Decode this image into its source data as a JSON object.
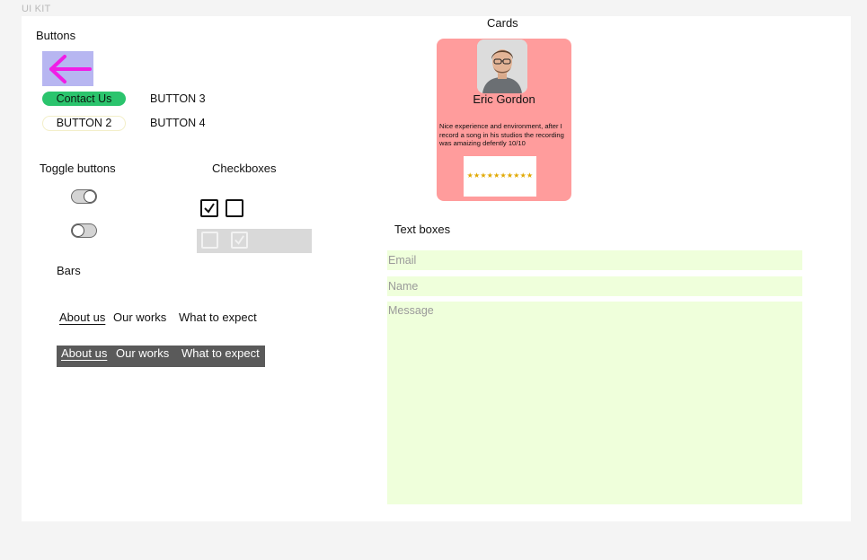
{
  "page_label": "UI KIT",
  "sections": {
    "buttons": "Buttons",
    "toggles": "Toggle buttons",
    "checkboxes": "Checkboxes",
    "bars": "Bars",
    "cards": "Cards",
    "text_boxes": "Text boxes"
  },
  "buttons": {
    "back_icon": "arrow-left-icon",
    "contact_label": "Contact Us",
    "button2_label": "BUTTON 2",
    "button3_label": "BUTTON 3",
    "button4_label": "BUTTON 4"
  },
  "toggles": [
    {
      "state": "on"
    },
    {
      "state": "off"
    }
  ],
  "checkboxes": {
    "enabled": [
      {
        "checked": true
      },
      {
        "checked": false
      }
    ],
    "disabled": [
      {
        "checked": false
      },
      {
        "checked": true
      }
    ]
  },
  "bars": {
    "light": [
      "About us",
      "Our works",
      "What to expect"
    ],
    "dark": [
      "About us",
      "Our works",
      "What to expect"
    ]
  },
  "card": {
    "name": "Eric Gordon",
    "review": "Nice experience and environment, after I record a song in his studios the recording was amaizing defently 10/10",
    "rating": "★★★★★★★★★★"
  },
  "text_boxes": {
    "email_placeholder": "Email",
    "name_placeholder": "Name",
    "message_placeholder": "Message"
  },
  "colors": {
    "accent_green": "#2bc46d",
    "back_button_bg": "#b7b6f1",
    "arrow": "#f01ee6",
    "card_bg": "#ff9c9c",
    "textbox_bg": "#efffdb"
  }
}
